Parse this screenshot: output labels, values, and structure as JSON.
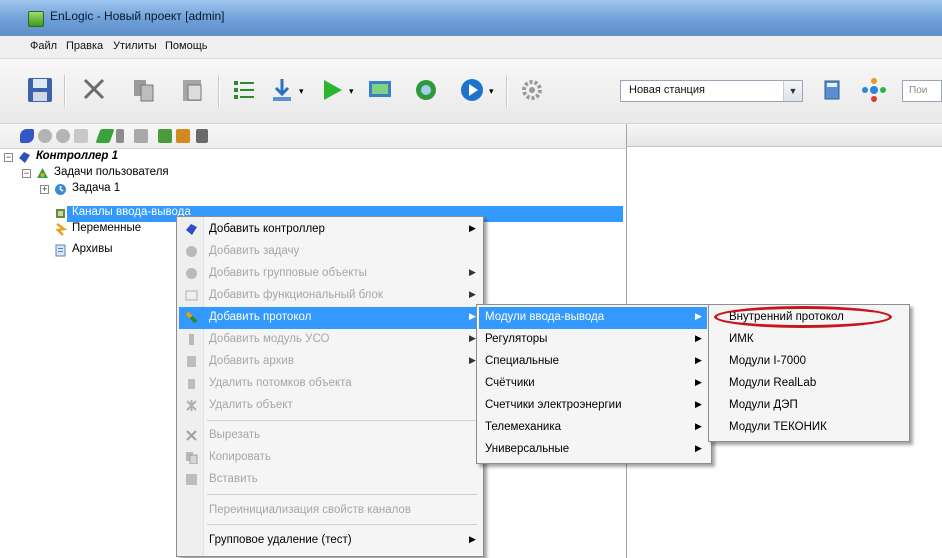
{
  "window": {
    "title": "EnLogic - Новый проект [admin]"
  },
  "menubar": [
    "Файл",
    "Правка",
    "Утилиты",
    "Помощь"
  ],
  "toolbar": {
    "station_combo": "Новая станция",
    "search_placeholder": "Пои",
    "icons": [
      "save-icon",
      "cut-icon",
      "copy-icon",
      "paste-icon",
      "list-icon",
      "download-icon",
      "play-icon",
      "monitor-icon",
      "green-icon",
      "circle-play-icon",
      "gear-icon",
      "calculator-icon",
      "network-icon"
    ]
  },
  "tree": {
    "controller": "Контроллер 1",
    "user_tasks": "Задачи пользователя",
    "task1": "Задача 1",
    "io_channels": "Каналы ввода-вывода",
    "variables": "Переменные",
    "archives": "Архивы"
  },
  "context_menu": {
    "items": [
      {
        "label": "Добавить контроллер",
        "enabled": true,
        "submenu": true,
        "icon": "controller-icon"
      },
      {
        "label": "Добавить задачу",
        "enabled": false,
        "submenu": false,
        "icon": "task-icon"
      },
      {
        "label": "Добавить групповые объекты",
        "enabled": false,
        "submenu": true,
        "icon": "group-icon"
      },
      {
        "label": "Добавить функциональный блок",
        "enabled": false,
        "submenu": true,
        "icon": "block-icon"
      },
      {
        "label": "Добавить протокол",
        "enabled": true,
        "submenu": true,
        "icon": "protocol-icon",
        "highlighted": true
      },
      {
        "label": "Добавить модуль УСО",
        "enabled": false,
        "submenu": true,
        "icon": "module-icon"
      },
      {
        "label": "Добавить архив",
        "enabled": false,
        "submenu": true,
        "icon": "archive-icon"
      },
      {
        "label": "Удалить потомков объекта",
        "enabled": false,
        "submenu": false,
        "icon": "delete-children-icon"
      },
      {
        "label": "Удалить объект",
        "enabled": false,
        "submenu": false,
        "icon": "delete-icon"
      },
      {
        "label": "Вырезать",
        "enabled": false,
        "submenu": false,
        "icon": "cut-icon"
      },
      {
        "label": "Копировать",
        "enabled": false,
        "submenu": false,
        "icon": "copy-icon"
      },
      {
        "label": "Вставить",
        "enabled": false,
        "submenu": false,
        "icon": "paste-icon"
      },
      {
        "label": "Переинициализация свойств каналов",
        "enabled": false,
        "submenu": false,
        "icon": ""
      },
      {
        "label": "Групповое удаление (тест)",
        "enabled": true,
        "submenu": true,
        "icon": ""
      }
    ]
  },
  "submenu_protocol": {
    "items": [
      {
        "label": "Модули ввода-вывода",
        "highlighted": true
      },
      {
        "label": "Регуляторы"
      },
      {
        "label": "Специальные"
      },
      {
        "label": "Счётчики"
      },
      {
        "label": "Счетчики электроэнергии"
      },
      {
        "label": "Телемеханика"
      },
      {
        "label": "Универсальные"
      }
    ]
  },
  "submenu_io": {
    "items": [
      {
        "label": "Внутренний протокол",
        "circled": true
      },
      {
        "label": "ИМК"
      },
      {
        "label": "Модули I-7000"
      },
      {
        "label": "Модули RealLab"
      },
      {
        "label": "Модули ДЭП"
      },
      {
        "label": "Модули ТЕКОНИК"
      }
    ]
  },
  "colors": {
    "selection": "#3399ff",
    "annotation": "#c8141e"
  }
}
